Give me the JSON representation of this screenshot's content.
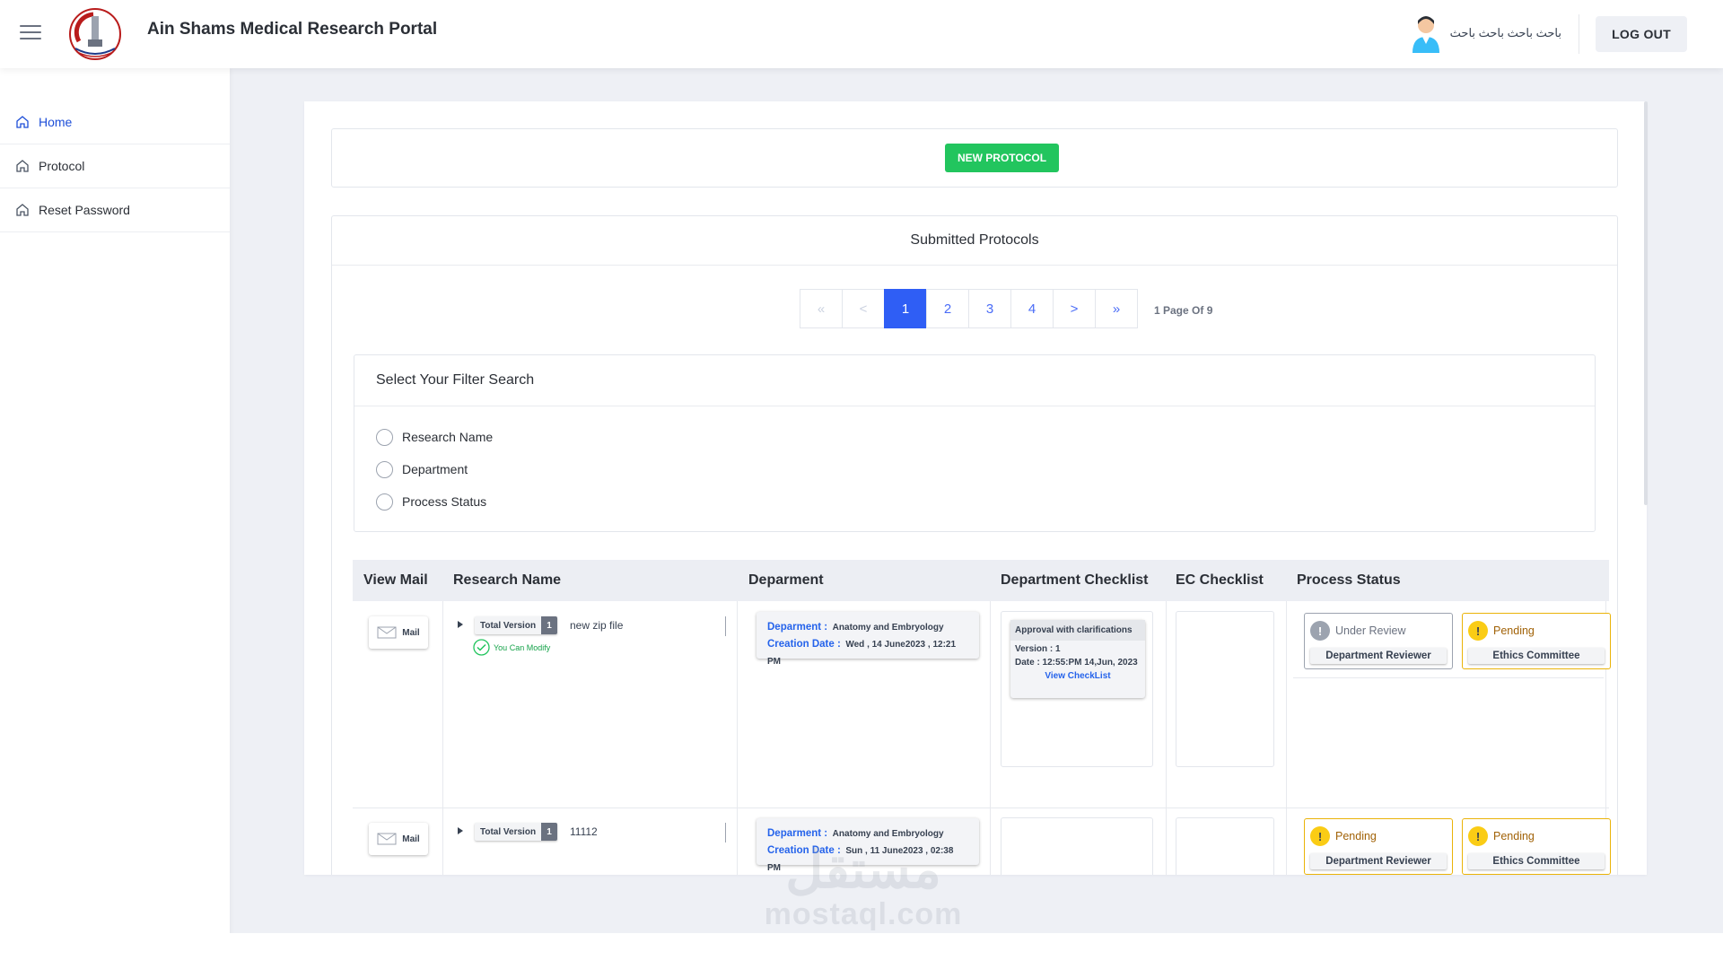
{
  "header": {
    "title": "Ain Shams Medical Research Portal",
    "user_name": "باحث باحث باحث باحث",
    "logout_label": "LOG OUT"
  },
  "sidebar": {
    "items": [
      {
        "label": "Home",
        "icon": "home-icon",
        "active": true
      },
      {
        "label": "Protocol",
        "icon": "home-icon",
        "active": false
      },
      {
        "label": "Reset Password",
        "icon": "home-icon",
        "active": false
      }
    ]
  },
  "main": {
    "new_protocol_label": "NEW PROTOCOL",
    "submitted_title": "Submitted Protocols",
    "pagination": {
      "first": "«",
      "prev": "<",
      "pages": [
        "1",
        "2",
        "3",
        "4"
      ],
      "current": "1",
      "next": ">",
      "last": "»",
      "info": "1 Page Of 9"
    },
    "filter": {
      "title": "Select Your Filter Search",
      "options": [
        "Research Name",
        "Department",
        "Process Status"
      ]
    },
    "table": {
      "columns": [
        "View Mail",
        "Research Name",
        "Deparment",
        "Department Checklist",
        "EC Checklist",
        "Process Status"
      ],
      "rows": [
        {
          "mail_label": "Mail",
          "total_version_label": "Total Version",
          "total_version": "1",
          "research_name": "new zip file",
          "modify_text": "You Can Modify",
          "dept_label": "Deparment :",
          "dept_value": "Anatomy and Embryology",
          "date_label": "Creation Date :",
          "date_value": "Wed , 14 June2023 , 12:21 PM",
          "checklist": {
            "status": "Approval with clarifications",
            "version": "Version : 1",
            "date": "Date : 12:55:PM 14,Jun, 2023",
            "link": "View CheckList"
          },
          "statuses": [
            {
              "state": "Under Review",
              "who": "Department Reviewer",
              "kind": "review"
            },
            {
              "state": "Pending",
              "who": "Ethics Committee",
              "kind": "pending"
            }
          ]
        },
        {
          "mail_label": "Mail",
          "total_version_label": "Total Version",
          "total_version": "1",
          "research_name": "11112",
          "dept_label": "Deparment :",
          "dept_value": "Anatomy and Embryology",
          "date_label": "Creation Date :",
          "date_value": "Sun , 11 June2023 , 02:38 PM",
          "statuses": [
            {
              "state": "Pending",
              "who": "Department Reviewer",
              "kind": "pending"
            },
            {
              "state": "Pending",
              "who": "Ethics Committee",
              "kind": "pending"
            }
          ]
        }
      ]
    }
  },
  "watermark": {
    "arabic": "مستقل",
    "latin": "mostaql.com"
  },
  "colors": {
    "accent": "#2f5ef5",
    "success": "#22c55e",
    "pending": "#eab308",
    "link": "#2563eb"
  }
}
